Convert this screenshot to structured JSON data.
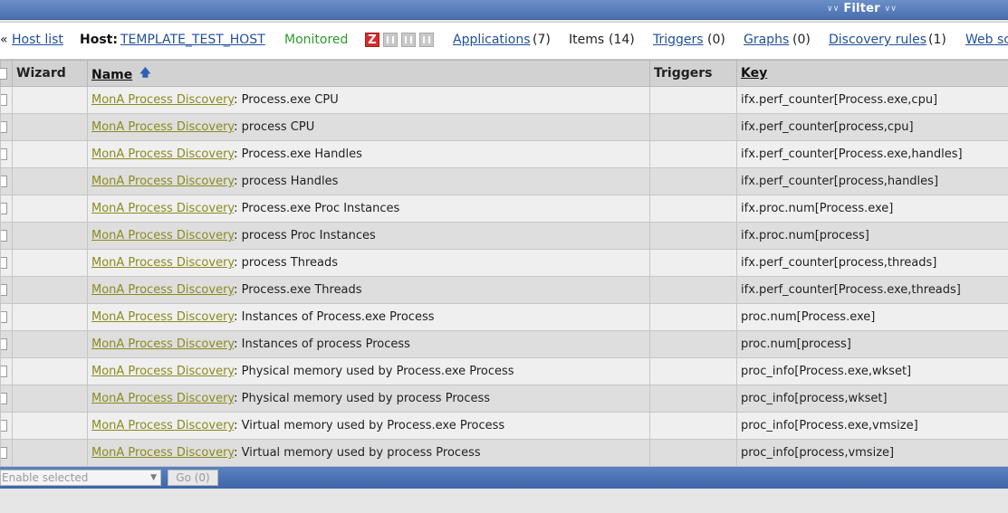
{
  "filter": {
    "label": "Filter"
  },
  "header": {
    "back_arrow": "«",
    "host_list": "Host list",
    "host_label": "Host:",
    "host_name": "TEMPLATE_TEST_HOST",
    "status": "Monitored",
    "availability_z": "Z",
    "applications": "Applications",
    "applications_count": "(7)",
    "items": "Items",
    "items_count": "(14)",
    "triggers": "Triggers",
    "triggers_count": "(0)",
    "graphs": "Graphs",
    "graphs_count": "(0)",
    "discovery": "Discovery rules",
    "discovery_count": "(1)",
    "web": "Web sc"
  },
  "table": {
    "columns": {
      "wizard": "Wizard",
      "name": "Name",
      "triggers": "Triggers",
      "key": "Key"
    },
    "rows": [
      {
        "prefix": "MonA Process Discovery",
        "name": ": Process.exe CPU",
        "key": "ifx.perf_counter[Process.exe,cpu]"
      },
      {
        "prefix": "MonA Process Discovery",
        "name": ": process CPU",
        "key": "ifx.perf_counter[process,cpu]"
      },
      {
        "prefix": "MonA Process Discovery",
        "name": ": Process.exe Handles",
        "key": "ifx.perf_counter[Process.exe,handles]"
      },
      {
        "prefix": "MonA Process Discovery",
        "name": ": process Handles",
        "key": "ifx.perf_counter[process,handles]"
      },
      {
        "prefix": "MonA Process Discovery",
        "name": ": Process.exe Proc Instances",
        "key": "ifx.proc.num[Process.exe]"
      },
      {
        "prefix": "MonA Process Discovery",
        "name": ": process Proc Instances",
        "key": "ifx.proc.num[process]"
      },
      {
        "prefix": "MonA Process Discovery",
        "name": ": process Threads",
        "key": "ifx.perf_counter[process,threads]"
      },
      {
        "prefix": "MonA Process Discovery",
        "name": ": Process.exe Threads",
        "key": "ifx.perf_counter[Process.exe,threads]"
      },
      {
        "prefix": "MonA Process Discovery",
        "name": ": Instances of Process.exe Process",
        "key": "proc.num[Process.exe]"
      },
      {
        "prefix": "MonA Process Discovery",
        "name": ": Instances of process Process",
        "key": "proc.num[process]"
      },
      {
        "prefix": "MonA Process Discovery",
        "name": ": Physical memory used by Process.exe Process",
        "key": "proc_info[Process.exe,wkset]"
      },
      {
        "prefix": "MonA Process Discovery",
        "name": ": Physical memory used by process Process",
        "key": "proc_info[process,wkset]"
      },
      {
        "prefix": "MonA Process Discovery",
        "name": ": Virtual memory used by Process.exe Process",
        "key": "proc_info[Process.exe,vmsize]"
      },
      {
        "prefix": "MonA Process Discovery",
        "name": ": Virtual memory used by process Process",
        "key": "proc_info[process,vmsize]"
      }
    ]
  },
  "footer": {
    "action_select": "Enable selected",
    "go_button": "Go (0)"
  }
}
